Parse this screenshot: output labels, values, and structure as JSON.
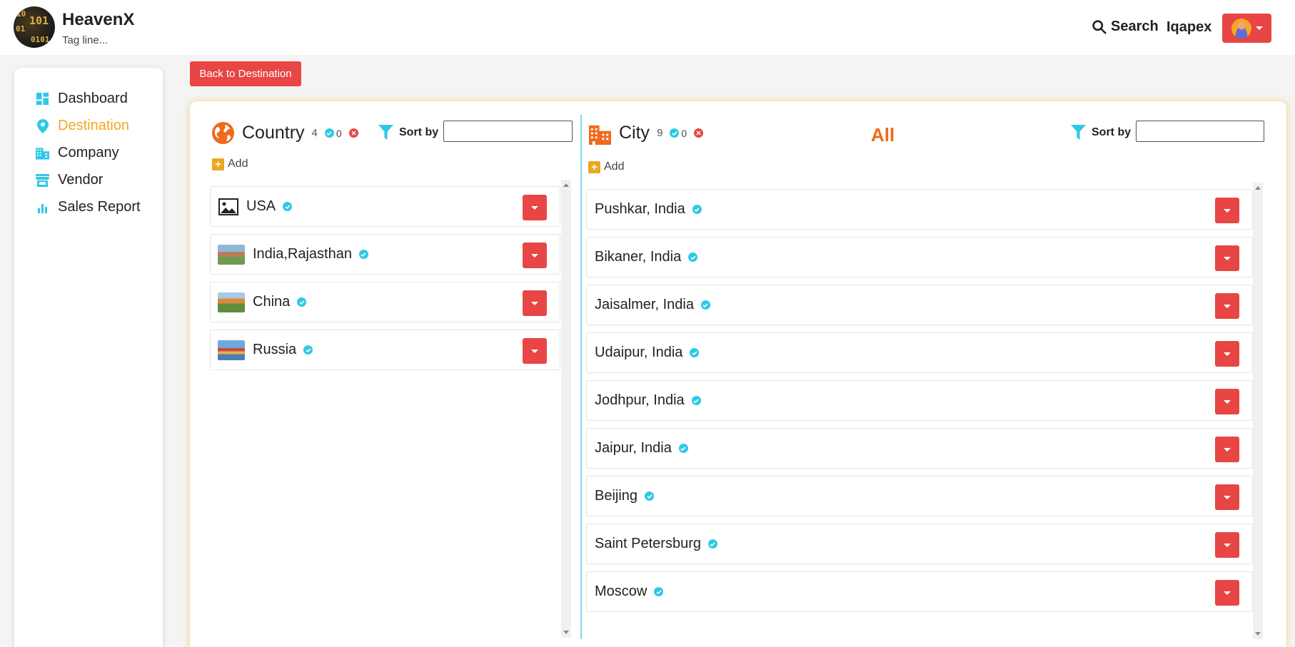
{
  "header": {
    "brand": "HeavenX",
    "tagline": "Tag line...",
    "logo_text": [
      "10",
      "101",
      "01",
      "0101"
    ],
    "search_label": "Search",
    "username": "Iqapex"
  },
  "sidebar": {
    "items": [
      {
        "label": "Dashboard",
        "icon": "dashboard-icon",
        "active": false
      },
      {
        "label": "Destination",
        "icon": "map-pin-icon",
        "active": true
      },
      {
        "label": "Company",
        "icon": "building-icon",
        "active": false
      },
      {
        "label": "Vendor",
        "icon": "store-icon",
        "active": false
      },
      {
        "label": "Sales Report",
        "icon": "bar-chart-icon",
        "active": false
      }
    ]
  },
  "back_button": "Back to Destination",
  "country": {
    "title": "Country",
    "count": "4",
    "verified_count": "0",
    "sort_label": "Sort by",
    "sort_value": "",
    "add_label": "Add",
    "items": [
      {
        "name": "USA",
        "thumb": "image-placeholder-icon"
      },
      {
        "name": "India,Rajasthan",
        "thumb": "photo"
      },
      {
        "name": "China",
        "thumb": "photo"
      },
      {
        "name": "Russia",
        "thumb": "photo"
      }
    ]
  },
  "city": {
    "title": "City",
    "count": "9",
    "verified_count": "0",
    "filter": "All",
    "sort_label": "Sort by",
    "sort_value": "",
    "add_label": "Add",
    "items": [
      {
        "name": "Pushkar, India"
      },
      {
        "name": "Bikaner, India"
      },
      {
        "name": "Jaisalmer, India"
      },
      {
        "name": "Udaipur, India"
      },
      {
        "name": "Jodhpur, India"
      },
      {
        "name": "Jaipur, India"
      },
      {
        "name": "Beijing"
      },
      {
        "name": "Saint Petersburg"
      },
      {
        "name": "Moscow"
      }
    ]
  },
  "colors": {
    "accent_red": "#e84545",
    "accent_orange": "#f06a1c",
    "accent_gold": "#f5a623",
    "verify_cyan": "#2ec8e8"
  }
}
